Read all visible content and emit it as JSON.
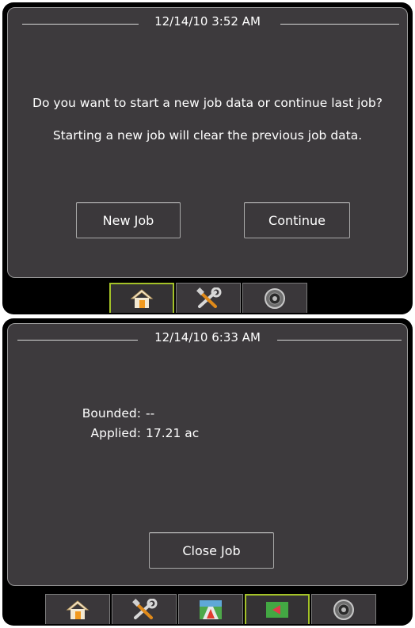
{
  "screen1": {
    "header": {
      "datetime": "12/14/10 3:52 AM"
    },
    "dialog": {
      "question": "Do you want to start a new job data or continue last job?",
      "warning": "Starting a new job will clear the previous job data."
    },
    "buttons": {
      "new_job_label": "New Job",
      "continue_label": "Continue"
    },
    "tabs": [
      {
        "icon": "home-icon",
        "active": true
      },
      {
        "icon": "tools-icon",
        "active": false
      },
      {
        "icon": "gauge-icon",
        "active": false
      }
    ]
  },
  "screen2": {
    "header": {
      "datetime": "12/14/10 6:33 AM"
    },
    "fields": {
      "bounded_label": "Bounded:",
      "bounded_value": "--",
      "applied_label": "Applied:",
      "applied_value": "17.21 ac"
    },
    "buttons": {
      "close_job_label": "Close Job"
    },
    "tabs": [
      {
        "icon": "home-icon",
        "active": false
      },
      {
        "icon": "tools-icon",
        "active": false
      },
      {
        "icon": "guidance-icon",
        "active": false
      },
      {
        "icon": "field-map-icon",
        "active": true
      },
      {
        "icon": "gauge-icon",
        "active": false
      }
    ]
  },
  "colors": {
    "panel": "#3d3a3d",
    "active_tab_border": "#a4c228",
    "text": "#ffffff"
  }
}
